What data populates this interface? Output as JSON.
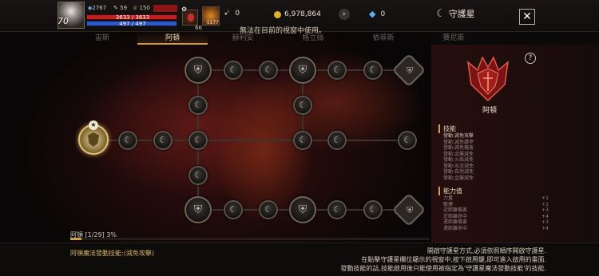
{
  "player": {
    "level": "70",
    "stat_a": "2767",
    "stat_b": "59",
    "stat_c": "150",
    "hp": "3633 / 3633",
    "mp": "497 / 497",
    "potion_count": "66",
    "item_count": "1177"
  },
  "currency": {
    "silver": "0",
    "gold": "6,978,864",
    "gem": "0"
  },
  "window_title": "守護星",
  "notice": "無法在目前的視窗中使用。",
  "tabs": [
    "宙斯",
    "阿頓",
    "赫利安",
    "格立絲",
    "依菲斯",
    "賽尼斯"
  ],
  "active_tab": 1,
  "constellation": {
    "name": "阿頓",
    "progress_label": "阿頓 [1/29] 3%",
    "progress_fraction": 0.03
  },
  "skills": {
    "header": "技能",
    "items": [
      "發動:減免攻擊",
      "發動:減免護甲",
      "發動:減免傷害",
      "發動:金屬減免",
      "發動:火焰減免",
      "發動:水流減免",
      "發動:自然減免",
      "發動:金屬減免"
    ]
  },
  "abilities": {
    "header": "能力值",
    "items": [
      {
        "k": "力量",
        "v": "+1"
      },
      {
        "k": "敏捷",
        "v": "+1"
      },
      {
        "k": "近距離傷害",
        "v": "+3"
      },
      {
        "k": "近距離命中",
        "v": "+4"
      },
      {
        "k": "遠距離傷害",
        "v": "+3"
      },
      {
        "k": "遠距離命中",
        "v": "+4"
      }
    ]
  },
  "magic_skill": "阿頓魔法發動技能:(減免攻擊)",
  "instructions": [
    "開啟守護星方式,必須依照順序開啟守護星.",
    "在點擊守護星欄位顯示的視窗中,按下啟用鍵,即可進入啟用的畫面.",
    "發動技能的話,技能啟用後只能使用被指定為'守護星魔法發動技能'的技能."
  ],
  "icons": {
    "close": "close-icon",
    "help": "help-icon",
    "arrow": "arrow-right-icon",
    "gem": "gem-icon",
    "gold": "gold-coin-icon",
    "gear": "gear-icon"
  },
  "colors": {
    "accent": "#c9a24a",
    "hp": "#c41e1e",
    "mp": "#2f58c8"
  }
}
